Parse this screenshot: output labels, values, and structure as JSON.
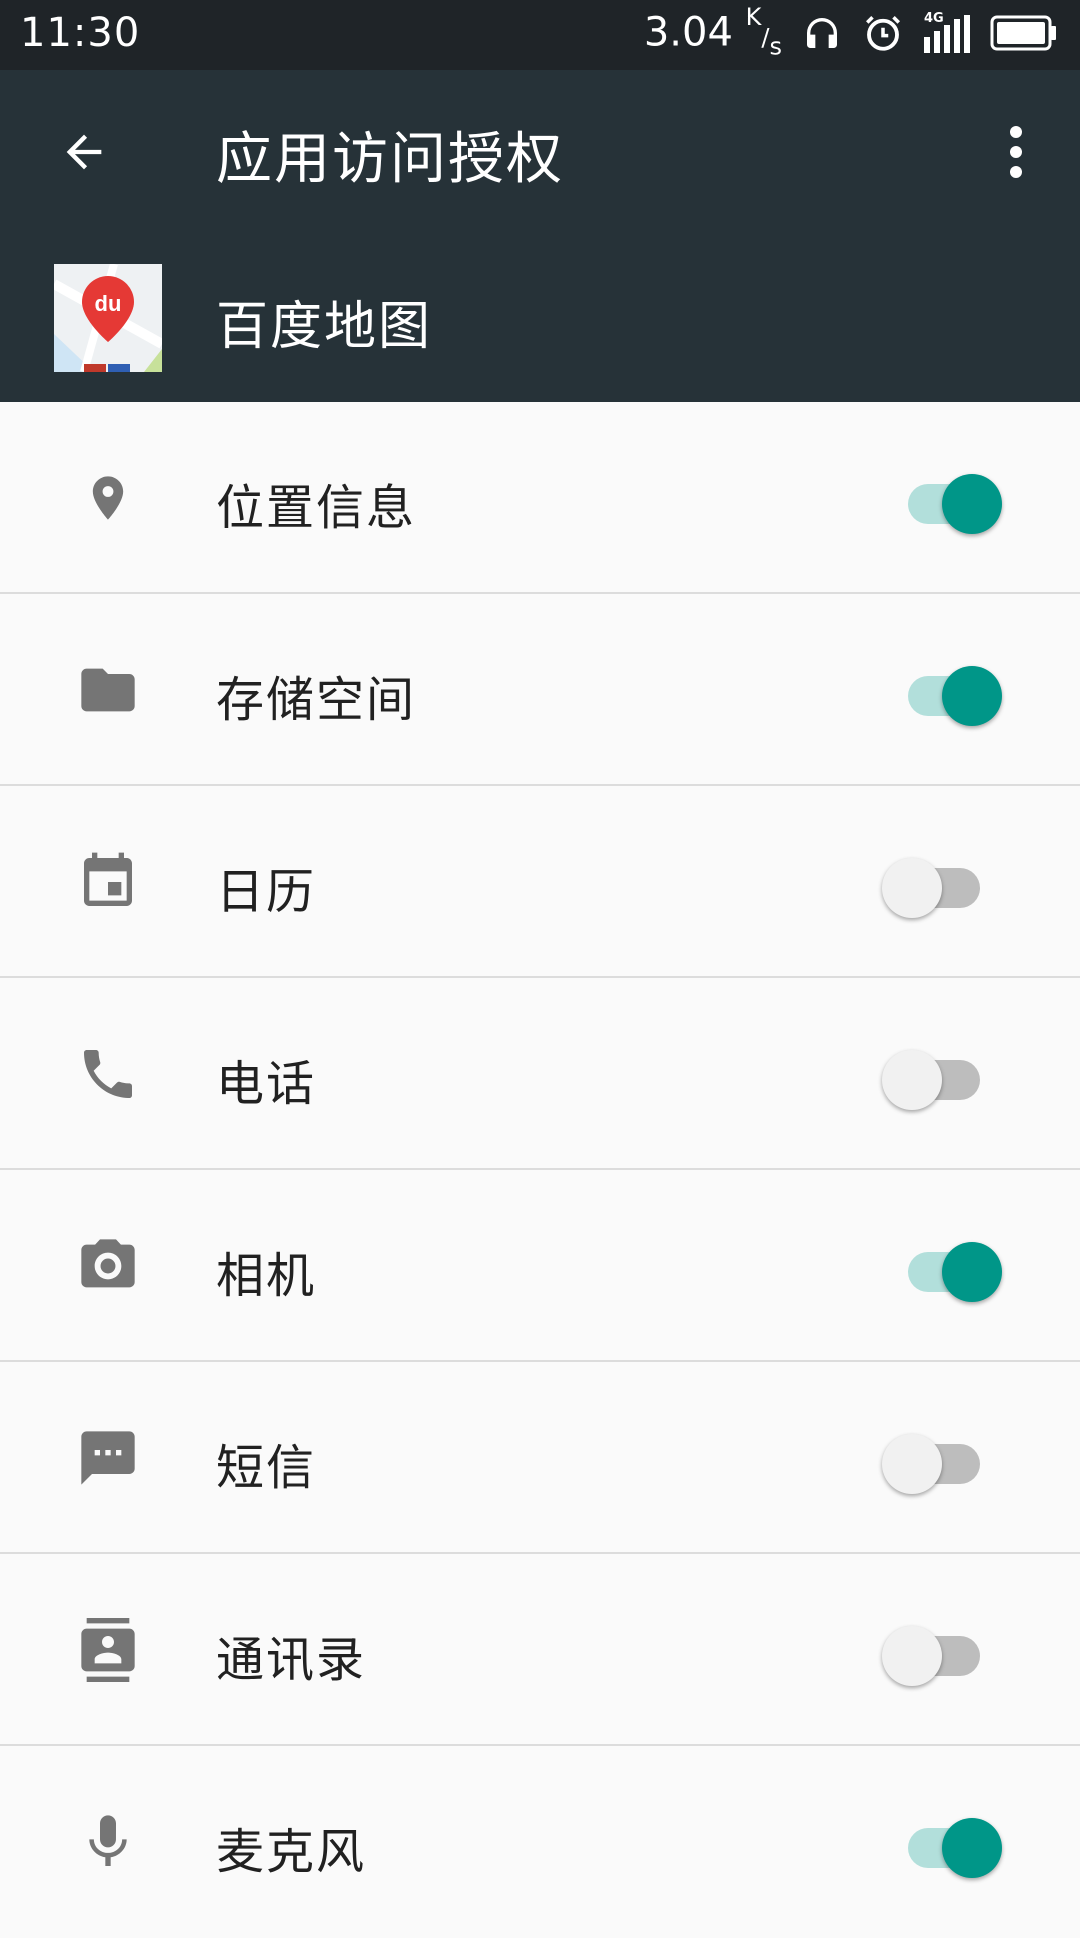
{
  "status_bar": {
    "time": "11:30",
    "speed": "3.04",
    "speed_unit_top": "K",
    "speed_unit_bottom": "s",
    "network": "4G"
  },
  "app_bar": {
    "title": "应用访问授权"
  },
  "app": {
    "name": "百度地图",
    "icon_badge": "du"
  },
  "permissions": [
    {
      "label": "位置信息",
      "icon": "location-icon",
      "enabled": true
    },
    {
      "label": "存储空间",
      "icon": "folder-icon",
      "enabled": true
    },
    {
      "label": "日历",
      "icon": "calendar-icon",
      "enabled": false
    },
    {
      "label": "电话",
      "icon": "phone-icon",
      "enabled": false
    },
    {
      "label": "相机",
      "icon": "camera-icon",
      "enabled": true
    },
    {
      "label": "短信",
      "icon": "message-icon",
      "enabled": false
    },
    {
      "label": "通讯录",
      "icon": "contacts-icon",
      "enabled": false
    },
    {
      "label": "麦克风",
      "icon": "microphone-icon",
      "enabled": true
    }
  ],
  "colors": {
    "status_bar": "#1f2428",
    "app_bar": "#263238",
    "accent": "#009688",
    "accent_track": "#b2dfdb",
    "icon": "#757575"
  }
}
